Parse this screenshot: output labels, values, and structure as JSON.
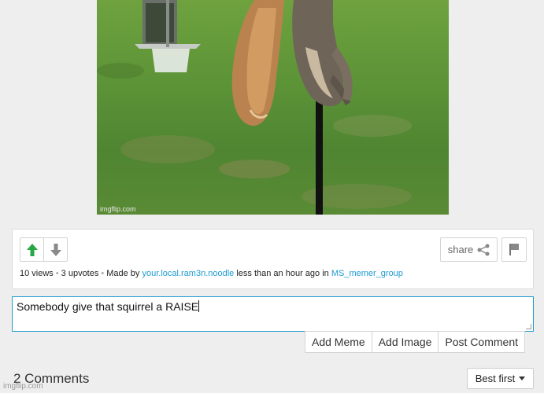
{
  "meme": {
    "watermark": "imgflip.com"
  },
  "post": {
    "views": "10 views",
    "upvotes": "3 upvotes",
    "made_by": "Made by",
    "author": "your.local.ram3n.noodle",
    "time": "less than an hour ago in",
    "stream": "MS_memer_group",
    "share_label": "share"
  },
  "comment_input": {
    "value": "Somebody give that squirrel a RAISE"
  },
  "actions": {
    "add_meme": "Add Meme",
    "add_image": "Add Image",
    "post_comment": "Post Comment"
  },
  "comments": {
    "title": "2 Comments",
    "sort": "Best first"
  },
  "footer": {
    "watermark": "imgflip.com"
  },
  "colors": {
    "upvote_active": "#28a745",
    "link": "#1d9bd1",
    "focus_border": "#1d9bd1"
  }
}
